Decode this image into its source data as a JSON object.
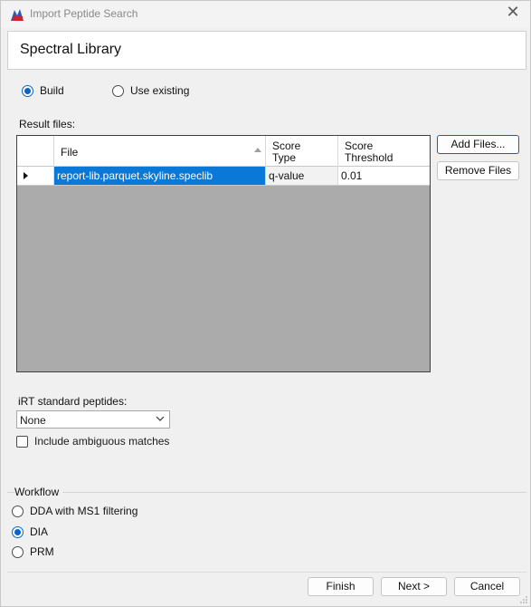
{
  "window": {
    "title": "Import Peptide Search",
    "close_glyph": "✕"
  },
  "header": {
    "title": "Spectral Library"
  },
  "library_mode": {
    "options": [
      {
        "label": "Build",
        "checked": true
      },
      {
        "label": "Use existing",
        "checked": false
      }
    ]
  },
  "result_files": {
    "label": "Result files:",
    "columns": [
      {
        "label": "File",
        "sorted": "ascending"
      },
      {
        "label": "Score\nType"
      },
      {
        "label": "Score\nThreshold"
      }
    ],
    "columns_text": {
      "file": "File",
      "score_type_1": "Score",
      "score_type_2": "Type",
      "threshold_1": "Score",
      "threshold_2": "Threshold"
    },
    "rows": [
      {
        "file": "report-lib.parquet.skyline.speclib",
        "score_type": "q-value",
        "threshold": "0.01"
      }
    ],
    "add_button": "Add Files...",
    "remove_button": "Remove Files"
  },
  "irt": {
    "label": "iRT standard peptides:",
    "selected": "None",
    "include_ambiguous_label": "Include ambiguous matches",
    "include_ambiguous_checked": false
  },
  "workflow": {
    "label": "Workflow",
    "options": [
      {
        "label": "DDA with MS1 filtering",
        "checked": false
      },
      {
        "label": "DIA",
        "checked": true
      },
      {
        "label": "PRM",
        "checked": false
      }
    ]
  },
  "footer": {
    "finish": "Finish",
    "next": "Next >",
    "cancel": "Cancel"
  },
  "colors": {
    "accent": "#0a64c8",
    "selection": "#0a78d7",
    "grid_background": "#ababab"
  }
}
